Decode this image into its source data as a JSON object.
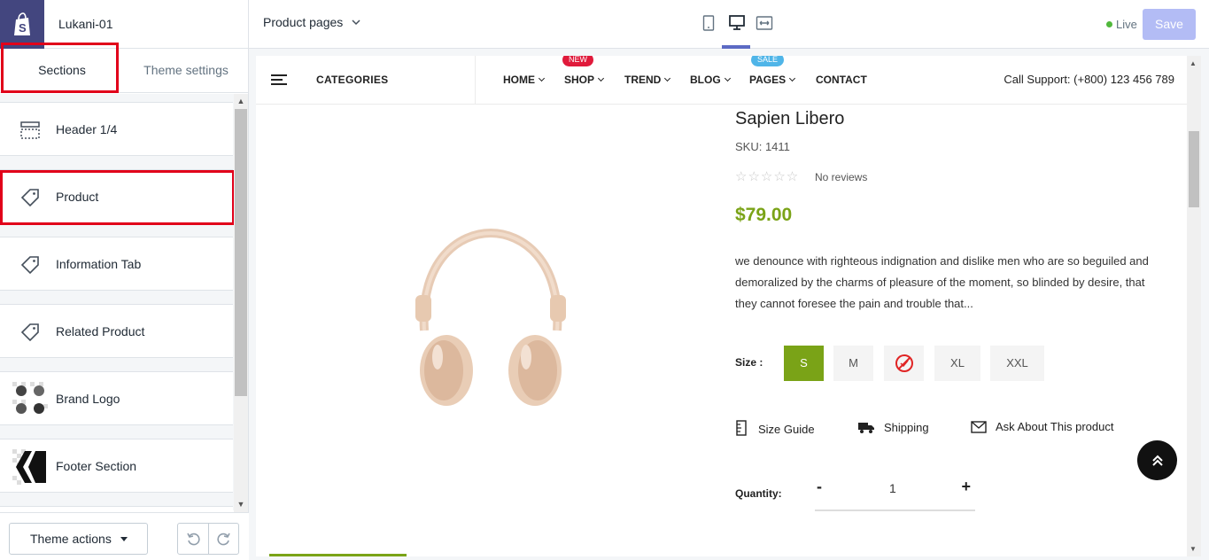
{
  "store": {
    "name": "Lukani-01"
  },
  "sidebar": {
    "tabs": [
      {
        "label": "Sections"
      },
      {
        "label": "Theme settings"
      }
    ],
    "sections": [
      {
        "label": "Header 1/4",
        "icon": "header-layout-icon"
      },
      {
        "label": "Product",
        "icon": "tag-icon"
      },
      {
        "label": "Information Tab",
        "icon": "tag-icon"
      },
      {
        "label": "Related Product",
        "icon": "tag-icon"
      },
      {
        "label": "Brand Logo",
        "icon": "brand-logo-thumbnail"
      },
      {
        "label": "Footer Section",
        "icon": "footer-thumbnail"
      }
    ],
    "theme_actions": "Theme actions"
  },
  "topbar": {
    "page_select": "Product pages",
    "status": "Live",
    "save_label": "Save",
    "status_color": "#50b83c",
    "save_color": "#b3bcf5"
  },
  "storefront": {
    "categories": "CATEGORIES",
    "nav": [
      {
        "label": "HOME"
      },
      {
        "label": "SHOP",
        "badge": "NEW"
      },
      {
        "label": "TREND"
      },
      {
        "label": "BLOG"
      },
      {
        "label": "PAGES",
        "badge": "SALE"
      },
      {
        "label": "CONTACT"
      }
    ],
    "support": "Call Support: (+800) 123 456 789"
  },
  "product": {
    "title": "Sapien Libero",
    "sku": "SKU: 1411",
    "stars": "☆☆☆☆☆",
    "reviews": "No reviews",
    "price": "$79.00",
    "price_color": "#7aa317",
    "description": "we denounce with righteous indignation and dislike men who are so beguiled and demoralized by the charms of pleasure of the moment, so blinded by desire, that they cannot foresee the pain and trouble that...",
    "size_label": "Size :",
    "sizes": [
      {
        "label": "S",
        "selected": true
      },
      {
        "label": "M"
      },
      {
        "label": "",
        "unavailable": true
      },
      {
        "label": "XL"
      },
      {
        "label": "XXL"
      }
    ],
    "links": [
      {
        "label": "Size Guide"
      },
      {
        "label": "Shipping"
      },
      {
        "label": "Ask About This product"
      }
    ],
    "quantity_label": "Quantity:",
    "quantity": "1",
    "qty_minus": "-",
    "qty_plus": "+"
  }
}
